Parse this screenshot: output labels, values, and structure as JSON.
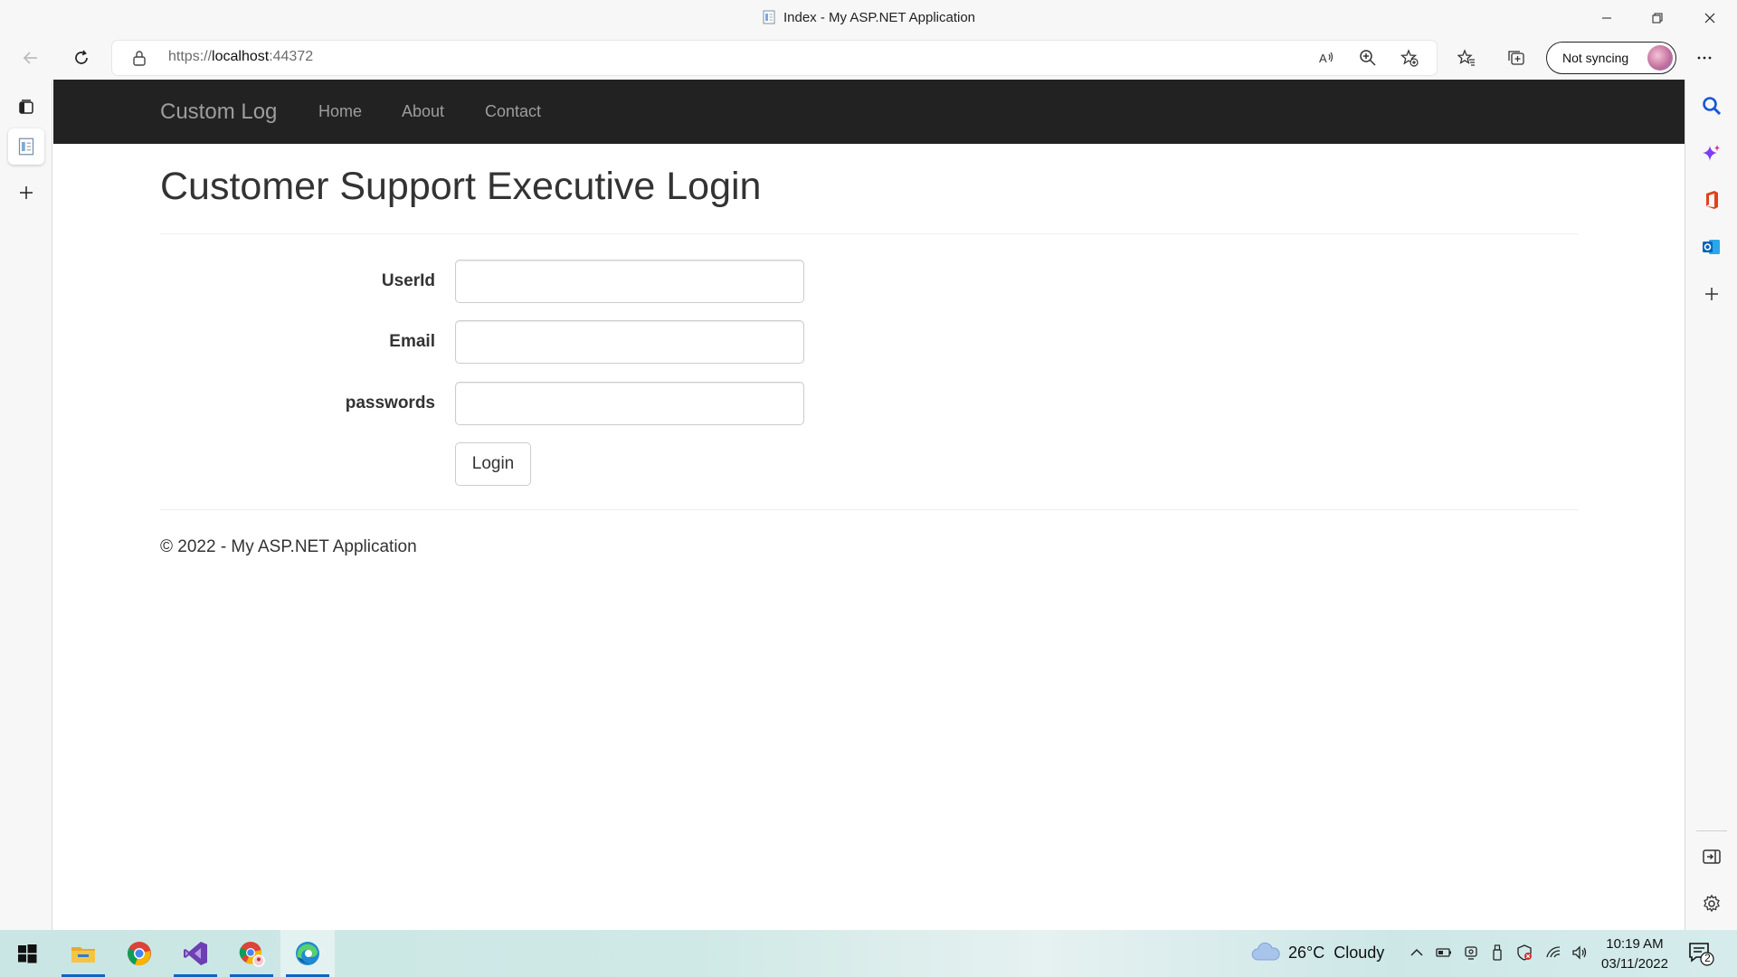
{
  "window": {
    "title": "Index - My ASP.NET Application",
    "controls": [
      "minimize",
      "restore",
      "close"
    ]
  },
  "toolbar": {
    "url_protocol": "https://",
    "url_host": "localhost",
    "url_port": ":44372",
    "profile_label": "Not syncing"
  },
  "site": {
    "brand": "Custom Log",
    "nav": [
      "Home",
      "About",
      "Contact"
    ]
  },
  "page": {
    "title": "Customer Support Executive Login",
    "fields": [
      {
        "label": "UserId",
        "value": "",
        "placeholder": ""
      },
      {
        "label": "Email",
        "value": "",
        "placeholder": ""
      },
      {
        "label": "passwords",
        "value": "",
        "placeholder": ""
      }
    ],
    "login_label": "Login",
    "footer": "© 2022 - My ASP.NET Application"
  },
  "taskbar": {
    "apps": [
      "windows-start-icon",
      "file-explorer-icon",
      "chrome-icon",
      "visual-studio-icon",
      "chrome-profile-icon",
      "edge-icon"
    ],
    "weather_temp": "26°C",
    "weather_desc": "Cloudy",
    "time": "10:19 AM",
    "date": "03/11/2022",
    "notification_count": "2"
  },
  "colors": {
    "navbar_bg": "#222222",
    "navbar_text": "#9d9d9d",
    "browser_chrome": "#f7f7f7",
    "edge_accent": "#0a66c2"
  }
}
